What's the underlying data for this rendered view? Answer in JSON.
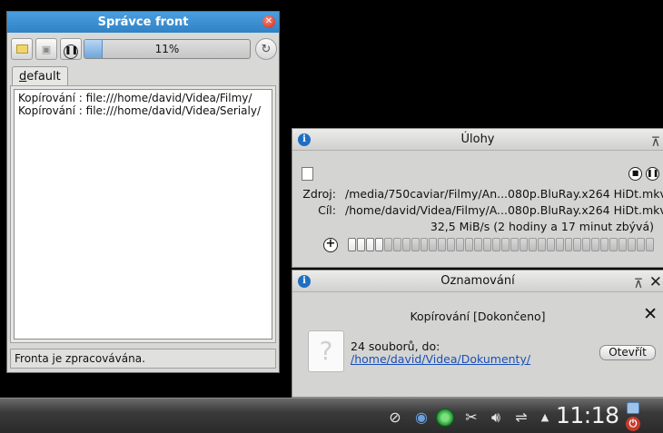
{
  "queue_manager": {
    "title": "Správce front",
    "progress_percent": 11,
    "progress_text": "11%",
    "tab_label_first": "d",
    "tab_label_rest": "efault",
    "jobs": [
      "Kopírování : file:///home/david/Videa/Filmy/",
      "Kopírování : file:///home/david/Videa/Serialy/"
    ],
    "status": "Fronta je zpracovávána."
  },
  "jobs_panel": {
    "title": "Úlohy",
    "source_label": "Zdroj:",
    "source_value": "/media/750caviar/Filmy/An...080p.BluRay.x264 HiDt.mkv",
    "dest_label": "Cíl:",
    "dest_value": "/home/david/Videa/Filmy/A...080p.BluRay.x264 HiDt.mkv",
    "speed": "32,5 MiB/s (2 hodiny a 17 minut zbývá)",
    "progress_segments_total": 34,
    "progress_segments_done": 4
  },
  "notifications_panel": {
    "title": "Oznamování",
    "subtitle": "Kopírování [Dokončeno]",
    "message": "24 souborů, do:",
    "link": "/home/david/Videa/Dokumenty/",
    "open_button": "Otevřít"
  },
  "taskbar": {
    "clock": "11:18"
  },
  "colors": {
    "title_blue": "#2f82c6",
    "progress_blue": "#6ea5db",
    "link_blue": "#1a4fb8",
    "tray_green": "#22a83a",
    "power_red": "#c63a2c"
  }
}
